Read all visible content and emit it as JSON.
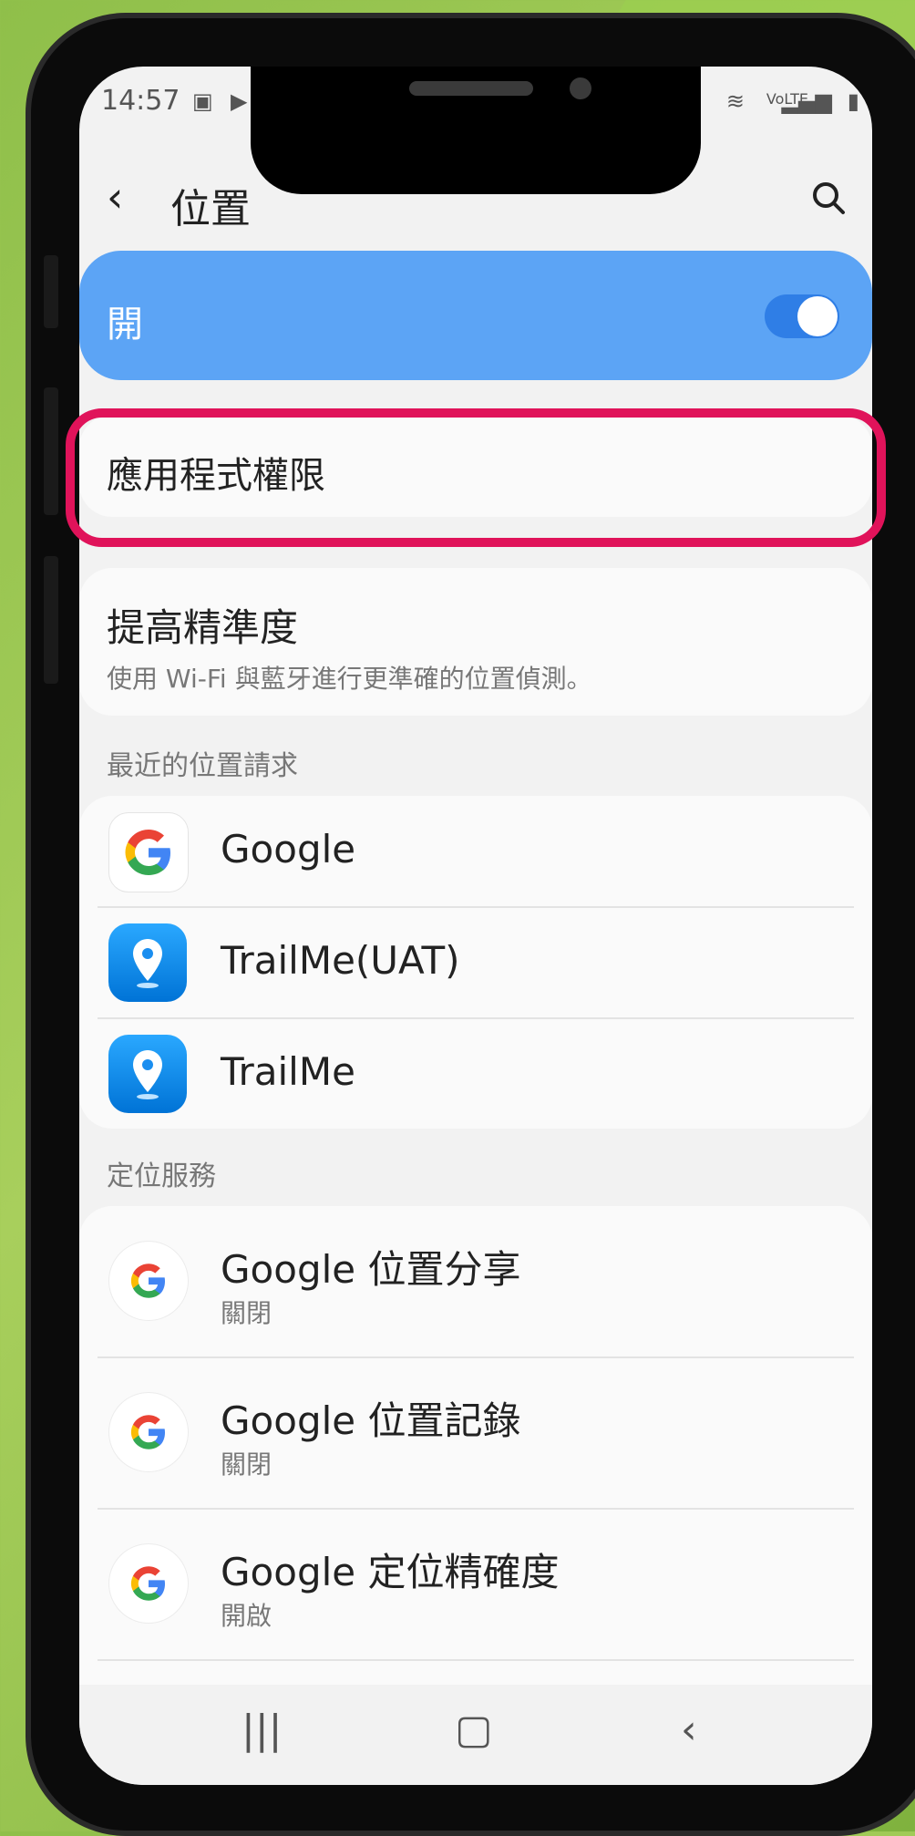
{
  "status_bar": {
    "time": "14:57"
  },
  "header": {
    "title": "位置"
  },
  "location_toggle": {
    "label": "開",
    "state": "on"
  },
  "permissions": {
    "label": "應用程式權限"
  },
  "accuracy": {
    "title": "提高精準度",
    "subtitle": "使用 Wi-Fi 與藍牙進行更準確的位置偵測。"
  },
  "recent_requests": {
    "heading": "最近的位置請求",
    "apps": [
      {
        "name": "Google",
        "icon": "google-icon"
      },
      {
        "name": "TrailMe(UAT)",
        "icon": "trailme-icon"
      },
      {
        "name": "TrailMe",
        "icon": "trailme-icon"
      }
    ]
  },
  "location_services": {
    "heading": "定位服務",
    "items": [
      {
        "name": "Google 位置分享",
        "status": "關閉"
      },
      {
        "name": "Google 位置記錄",
        "status": "關閉"
      },
      {
        "name": "Google 定位精確度",
        "status": "開啟"
      }
    ]
  },
  "colors": {
    "toggle_card": "#5ca4f5",
    "highlight": "#e0135a",
    "background": "#a8cf5c"
  }
}
